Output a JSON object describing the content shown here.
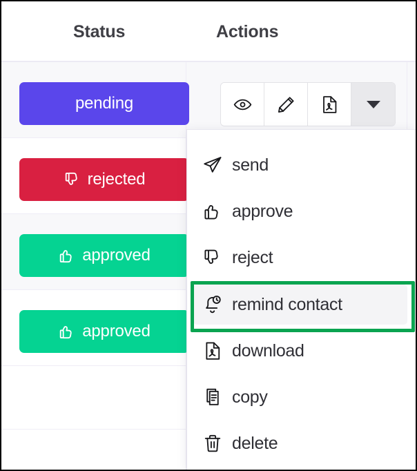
{
  "table": {
    "columns": [
      {
        "key": "status",
        "label": "Status"
      },
      {
        "key": "actions",
        "label": "Actions"
      }
    ],
    "rows": [
      {
        "status": {
          "label": "pending",
          "icon": "none",
          "color": "#5A46EB"
        }
      },
      {
        "status": {
          "label": "rejected",
          "icon": "thumbs-down",
          "color": "#D92041"
        }
      },
      {
        "status": {
          "label": "approved",
          "icon": "thumbs-up",
          "color": "#05D392"
        }
      },
      {
        "status": {
          "label": "approved",
          "icon": "thumbs-up",
          "color": "#05D392"
        }
      }
    ]
  },
  "action_buttons": [
    {
      "name": "view-button",
      "icon": "eye-icon",
      "state": "default"
    },
    {
      "name": "edit-button",
      "icon": "pencil-icon",
      "state": "default"
    },
    {
      "name": "pdf-button",
      "icon": "pdf-file-icon",
      "state": "default"
    },
    {
      "name": "more-button",
      "icon": "caret-down-icon",
      "state": "active"
    }
  ],
  "dropdown": {
    "open": true,
    "items": [
      {
        "label": "send",
        "icon": "paper-plane-icon",
        "highlighted": false
      },
      {
        "label": "approve",
        "icon": "thumbs-up-icon",
        "highlighted": false
      },
      {
        "label": "reject",
        "icon": "thumbs-down-icon",
        "highlighted": false
      },
      {
        "label": "remind contact",
        "icon": "bell-clock-icon",
        "highlighted": true
      },
      {
        "label": "download",
        "icon": "pdf-file-icon",
        "highlighted": false
      },
      {
        "label": "copy",
        "icon": "copy-icon",
        "highlighted": false
      },
      {
        "label": "delete",
        "icon": "trash-icon",
        "highlighted": false
      }
    ],
    "selection_highlight_color": "#0AA450",
    "selected_item_label": "remind contact"
  },
  "colors": {
    "pending": "#5A46EB",
    "rejected": "#D92041",
    "approved": "#05D392",
    "selection": "#0AA450",
    "header_text": "#3F3F45",
    "menu_text": "#2F2F35",
    "row_tint": "#F8F8FA"
  }
}
